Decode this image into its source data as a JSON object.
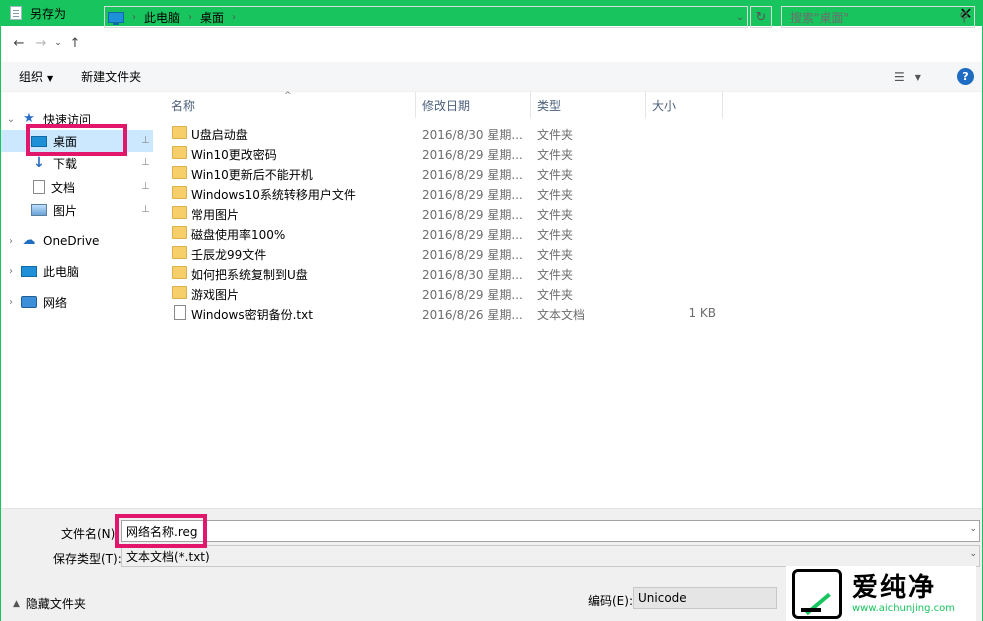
{
  "window": {
    "title": "另存为"
  },
  "address": {
    "crumbs": [
      "此电脑",
      "桌面"
    ]
  },
  "search": {
    "placeholder": "搜索\"桌面\""
  },
  "toolbar": {
    "organize": "组织",
    "new_folder": "新建文件夹"
  },
  "columns": {
    "name": "名称",
    "date": "修改日期",
    "type": "类型",
    "size": "大小"
  },
  "sidebar": {
    "quick_access": "快速访问",
    "items": [
      {
        "label": "桌面",
        "pinned": true
      },
      {
        "label": "下载",
        "pinned": true
      },
      {
        "label": "文档",
        "pinned": true
      },
      {
        "label": "图片",
        "pinned": true
      }
    ],
    "onedrive": "OneDrive",
    "this_pc": "此电脑",
    "network": "网络"
  },
  "files": [
    {
      "name": "U盘启动盘",
      "date": "2016/8/30 星期...",
      "type": "文件夹",
      "size": "",
      "kind": "folder"
    },
    {
      "name": "Win10更改密码",
      "date": "2016/8/29 星期...",
      "type": "文件夹",
      "size": "",
      "kind": "folder"
    },
    {
      "name": "Win10更新后不能开机",
      "date": "2016/8/29 星期...",
      "type": "文件夹",
      "size": "",
      "kind": "folder"
    },
    {
      "name": "Windows10系统转移用户文件",
      "date": "2016/8/29 星期...",
      "type": "文件夹",
      "size": "",
      "kind": "folder"
    },
    {
      "name": "常用图片",
      "date": "2016/8/29 星期...",
      "type": "文件夹",
      "size": "",
      "kind": "folder"
    },
    {
      "name": "磁盘使用率100%",
      "date": "2016/8/29 星期...",
      "type": "文件夹",
      "size": "",
      "kind": "folder"
    },
    {
      "name": "壬辰龙99文件",
      "date": "2016/8/29 星期...",
      "type": "文件夹",
      "size": "",
      "kind": "folder"
    },
    {
      "name": "如何把系统复制到U盘",
      "date": "2016/8/30 星期...",
      "type": "文件夹",
      "size": "",
      "kind": "folder"
    },
    {
      "name": "游戏图片",
      "date": "2016/8/29 星期...",
      "type": "文件夹",
      "size": "",
      "kind": "folder"
    },
    {
      "name": "Windows密钥备份.txt",
      "date": "2016/8/26 星期...",
      "type": "文本文档",
      "size": "1 KB",
      "kind": "txt"
    }
  ],
  "form": {
    "filename_label": "文件名(N):",
    "filename_value": "网络名称.reg",
    "savetype_label": "保存类型(T):",
    "savetype_value": "文本文档(*.txt)",
    "hide_folders": "隐藏文件夹",
    "encoding_label": "编码(E):",
    "encoding_value": "Unicode"
  },
  "watermark": {
    "brand": "爱纯净",
    "url": "www.aichunjing.com"
  },
  "colors": {
    "titlebar": "#17c45d",
    "highlight": "#e0176b",
    "selection": "#cce8ff",
    "folder": "#f6cf6a"
  }
}
